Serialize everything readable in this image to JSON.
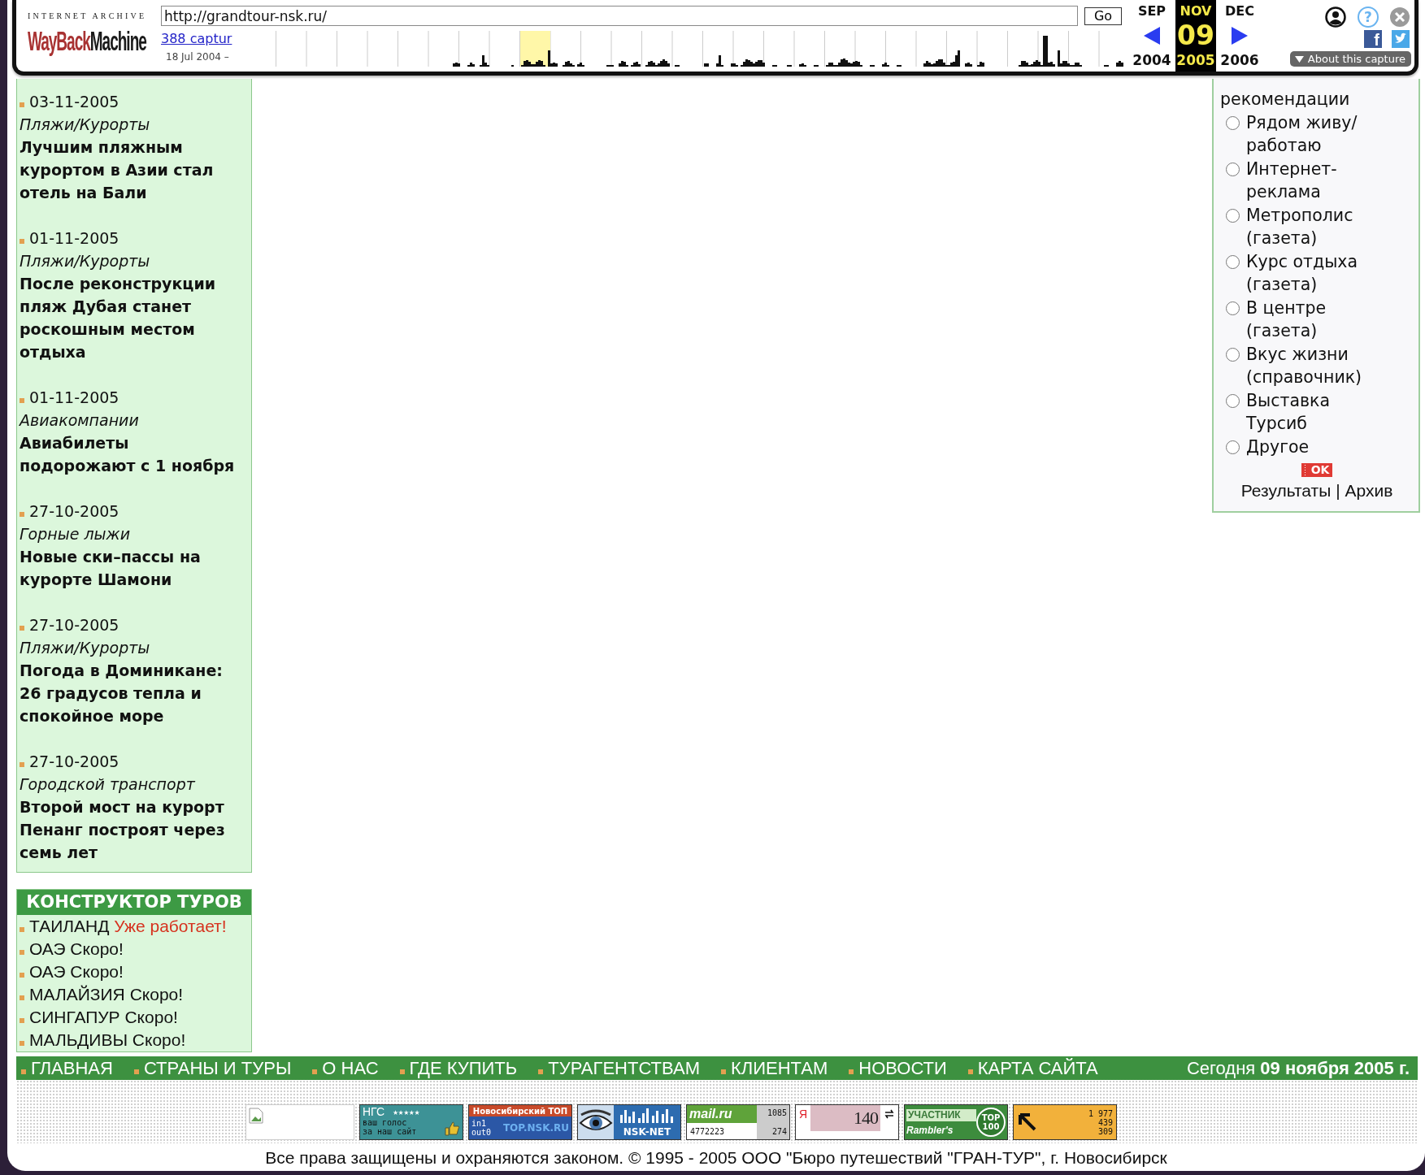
{
  "wayback": {
    "logo_top": "INTERNET ARCHIVE",
    "logo_way": "WayBack",
    "logo_machine": "Machine",
    "url": "http://grandtour-nsk.ru/",
    "go": "Go",
    "captures": "388 captur",
    "range": "18 Jul 2004 –",
    "months": [
      {
        "month": "SEP",
        "year": "2004",
        "selected": false
      },
      {
        "month": "NOV",
        "day": "09",
        "year": "2005",
        "selected": true
      },
      {
        "month": "DEC",
        "year": "2006",
        "selected": false
      }
    ],
    "help_glyph": "?",
    "facebook_glyph": "f",
    "about": "About this capture"
  },
  "news": [
    {
      "date": "03-11-2005",
      "category": "Пляжи/Курорты",
      "title": "Лучшим пляжным курортом в Азии стал отель на Бали"
    },
    {
      "date": "01-11-2005",
      "category": "Пляжи/Курорты",
      "title": "После реконструкции пляж Дубая станет роскошным местом отдыха"
    },
    {
      "date": "01-11-2005",
      "category": "Авиакомпании",
      "title": "Авиабилеты подорожают с 1 ноября"
    },
    {
      "date": "27-10-2005",
      "category": "Горные лыжи",
      "title": "Новые ски–пассы на курорте Шамони"
    },
    {
      "date": "27-10-2005",
      "category": "Пляжи/Курорты",
      "title": "Погода в Доминикане: 26 градусов тепла и спокойное море"
    },
    {
      "date": "27-10-2005",
      "category": "Городской транспорт",
      "title": "Второй мост на курорт Пенанг построят через семь лет"
    }
  ],
  "tours": {
    "title": "КОНСТРУКТОР ТУРОВ",
    "items": [
      {
        "name": "ТАИЛАНД",
        "status": "Уже работает!",
        "kind": "active"
      },
      {
        "name": "ОАЭ",
        "status": "Скоро!",
        "kind": "soon"
      },
      {
        "name": "ОАЭ",
        "status": "Скоро!",
        "kind": "soon"
      },
      {
        "name": "МАЛАЙЗИЯ",
        "status": "Скоро!",
        "kind": "soon"
      },
      {
        "name": "СИНГАПУР",
        "status": "Скоро!",
        "kind": "soon"
      },
      {
        "name": "МАЛЬДИВЫ",
        "status": "Скоро!",
        "kind": "soon"
      }
    ]
  },
  "poll": {
    "cut_option": "рекомендации",
    "options": [
      {
        "label": "Рядом живу/ работаю",
        "selected": false
      },
      {
        "label": "Интернет-реклама",
        "selected": false
      },
      {
        "label": "Метрополис (газета)",
        "selected": false
      },
      {
        "label": "Курс отдыха (газета)",
        "selected": false
      },
      {
        "label": "В центре (газета)",
        "selected": false
      },
      {
        "label": "Вкус жизни (справочник)",
        "selected": false
      },
      {
        "label": "Выставка Турсиб",
        "selected": false
      },
      {
        "label": "Другое",
        "selected": false
      }
    ],
    "ok": "OK",
    "links": [
      "Результаты",
      "Архив"
    ],
    "separator": "|"
  },
  "nav": [
    "ГЛАВНАЯ",
    "СТРАНЫ И ТУРЫ",
    "О НАС",
    "ГДЕ КУПИТЬ",
    "ТУРАГЕНТСТВАМ",
    "КЛИЕНТАМ",
    "НОВОСТИ",
    "КАРТА САЙТА"
  ],
  "today": "Сегодня **09 ноября 2005 г.**",
  "counters": [
    {
      "kind": "broken"
    },
    {
      "kind": "ngs",
      "texts": [
        "НГС",
        "★★★★★",
        "ваш голос",
        "за наш сайт"
      ]
    },
    {
      "kind": "toplist",
      "texts": [
        "Новосибирский ТОП",
        "TOP.NSK.RU",
        "in1 out0"
      ]
    },
    {
      "kind": "eye",
      "texts": [
        "NSK-NET"
      ]
    },
    {
      "kind": "mail",
      "texts": [
        "mail.ru",
        "4772223",
        "1085",
        "274"
      ]
    },
    {
      "kind": "yandex",
      "texts": [
        "Я",
        "140"
      ]
    },
    {
      "kind": "rambler",
      "texts": [
        "УЧАСТНИК",
        "Rambler's",
        "TOP",
        "100"
      ]
    },
    {
      "kind": "stats",
      "texts": [
        "1 977",
        "439",
        "309"
      ]
    }
  ],
  "copyright": "Все права защищены и охраняются законом. © 1995 - 2005 ООО \"Бюро путешествий \"ГРАН-ТУР\", г. Новосибирск"
}
